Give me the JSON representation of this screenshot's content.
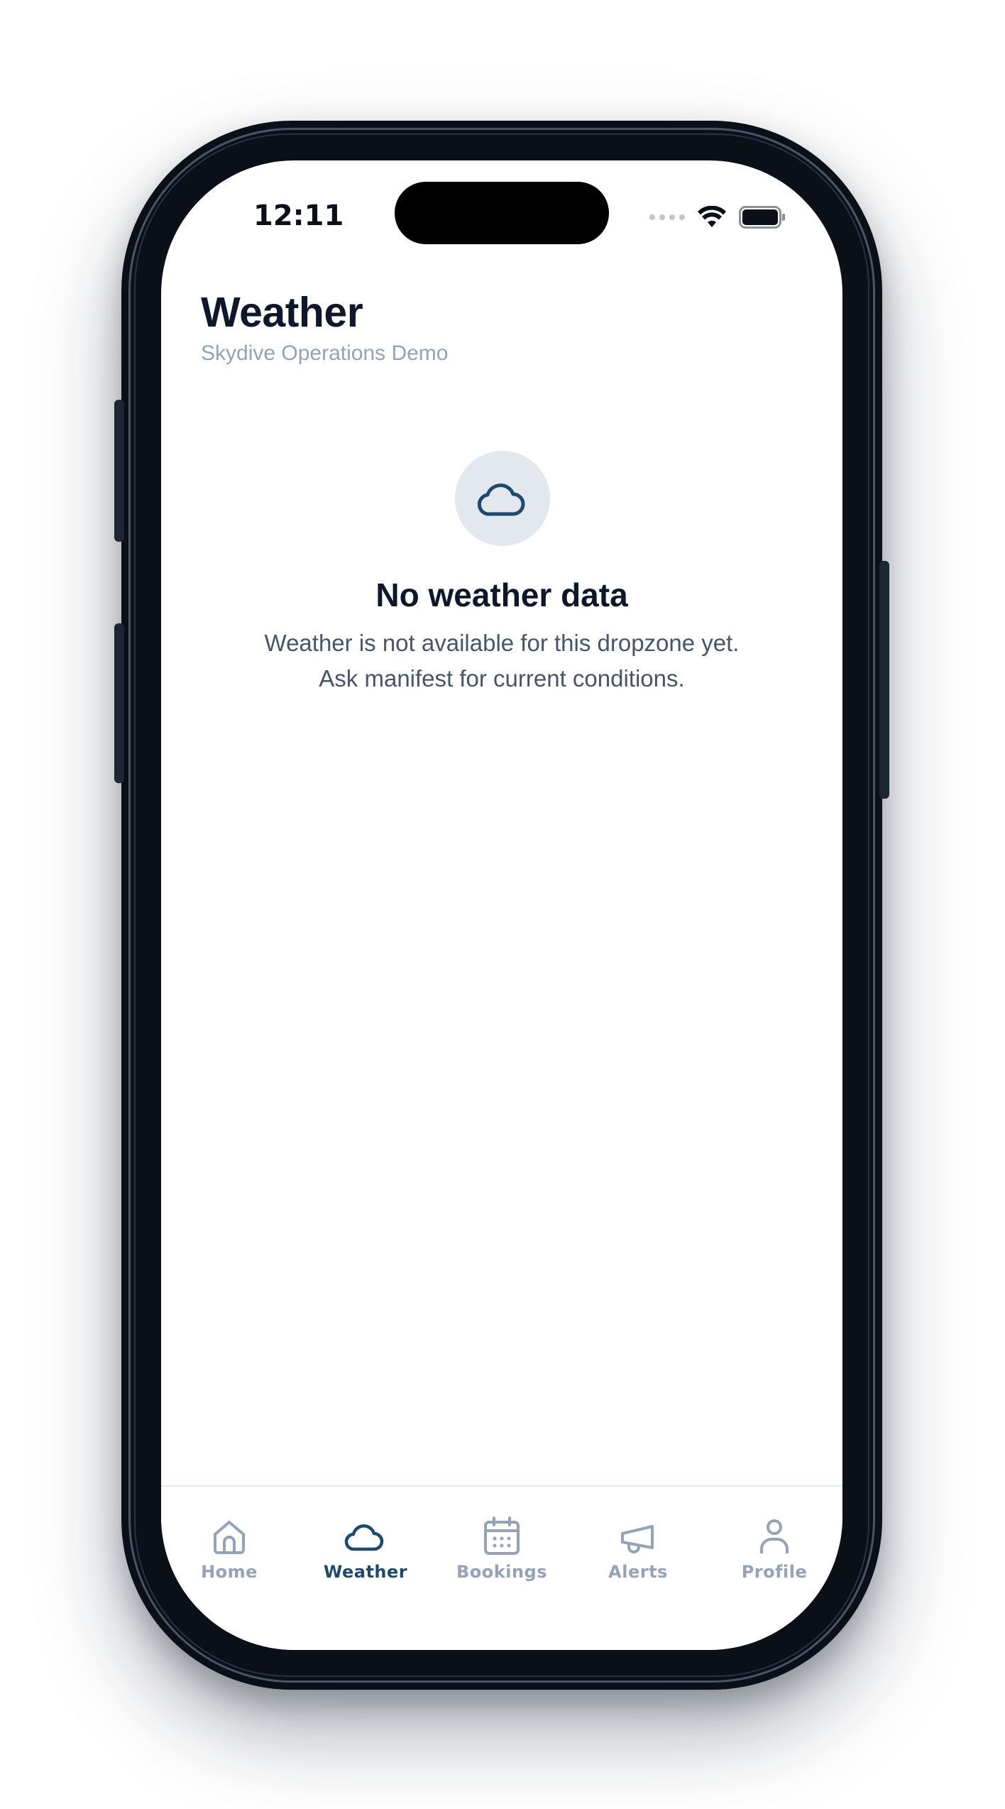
{
  "status_bar": {
    "time": "12:11"
  },
  "header": {
    "title": "Weather",
    "subtitle": "Skydive Operations Demo"
  },
  "empty_state": {
    "icon": "cloud-icon",
    "title": "No weather data",
    "message": "Weather is not available for this dropzone yet. Ask manifest for current conditions."
  },
  "tab_bar": {
    "active_tab": "Weather",
    "active_color": "#1e4a6e",
    "inactive_color": "#94a3b8",
    "tabs": [
      {
        "label": "Home",
        "icon": "home-icon"
      },
      {
        "label": "Weather",
        "icon": "cloud-icon"
      },
      {
        "label": "Bookings",
        "icon": "calendar-icon"
      },
      {
        "label": "Alerts",
        "icon": "megaphone-icon"
      },
      {
        "label": "Profile",
        "icon": "person-icon"
      }
    ]
  }
}
